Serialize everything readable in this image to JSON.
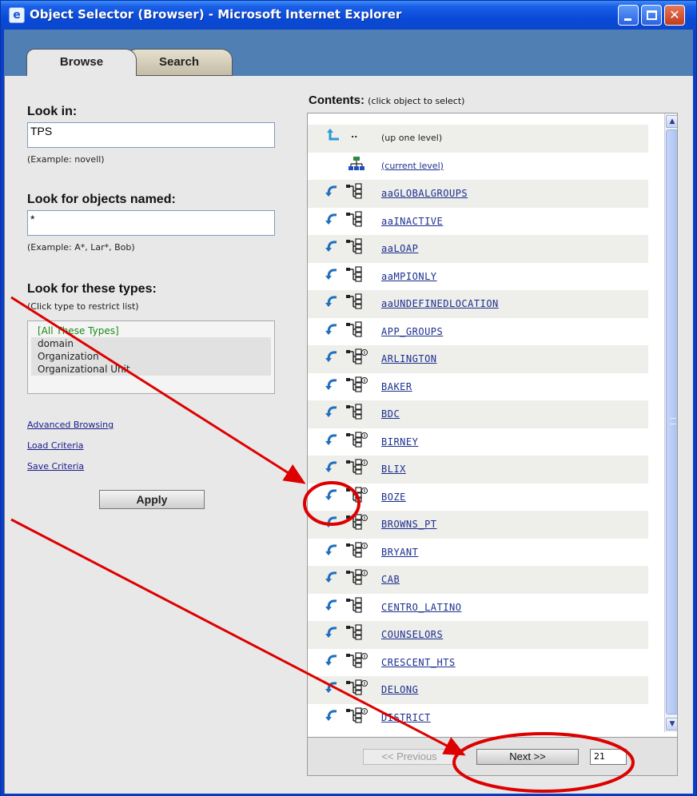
{
  "window": {
    "title": "Object Selector (Browser) - Microsoft Internet Explorer"
  },
  "tabs": {
    "browse": "Browse",
    "search": "Search"
  },
  "left": {
    "look_in_label": "Look in:",
    "look_in_value": "TPS",
    "look_in_hint": "(Example: novell)",
    "named_label": "Look for objects named:",
    "named_value": "*",
    "named_hint": "(Example: A*, Lar*, Bob)",
    "types_label": "Look for these types:",
    "types_hint": "(Click type to restrict list)",
    "types": [
      "[All These Types]",
      "domain",
      "Organization",
      "Organizational Unit"
    ],
    "links": [
      "Advanced Browsing",
      "Load Criteria",
      "Save Criteria"
    ],
    "apply_label": "Apply"
  },
  "contents": {
    "title": "Contents:",
    "subtitle": "(click object to select)",
    "up_dots": "..",
    "up_label": "(up one level)",
    "current_label": "(current level)",
    "items": [
      {
        "name": "aaGLOBALGROUPS",
        "badge": false
      },
      {
        "name": "aaINACTIVE",
        "badge": false
      },
      {
        "name": "aaLOAP",
        "badge": false
      },
      {
        "name": "aaMPIONLY",
        "badge": false
      },
      {
        "name": "aaUNDEFINEDLOCATION",
        "badge": false
      },
      {
        "name": "APP_GROUPS",
        "badge": false
      },
      {
        "name": "ARLINGTON",
        "badge": true
      },
      {
        "name": "BAKER",
        "badge": true
      },
      {
        "name": "BDC",
        "badge": false
      },
      {
        "name": "BIRNEY",
        "badge": true
      },
      {
        "name": "BLIX",
        "badge": true
      },
      {
        "name": "BOZE",
        "badge": true
      },
      {
        "name": "BROWNS_PT",
        "badge": true
      },
      {
        "name": "BRYANT",
        "badge": true
      },
      {
        "name": "CAB",
        "badge": true
      },
      {
        "name": "CENTRO_LATINO",
        "badge": false
      },
      {
        "name": "COUNSELORS",
        "badge": false
      },
      {
        "name": "CRESCENT_HTS",
        "badge": true
      },
      {
        "name": "DELONG",
        "badge": true
      },
      {
        "name": "DISTRICT",
        "badge": true
      }
    ],
    "prev_label": "<< Previous",
    "next_label": "Next >>",
    "page_value": "21"
  },
  "colors": {
    "annotation": "#dd0000",
    "link": "#1c2f8f",
    "title_bar": "#0a4ad8"
  }
}
